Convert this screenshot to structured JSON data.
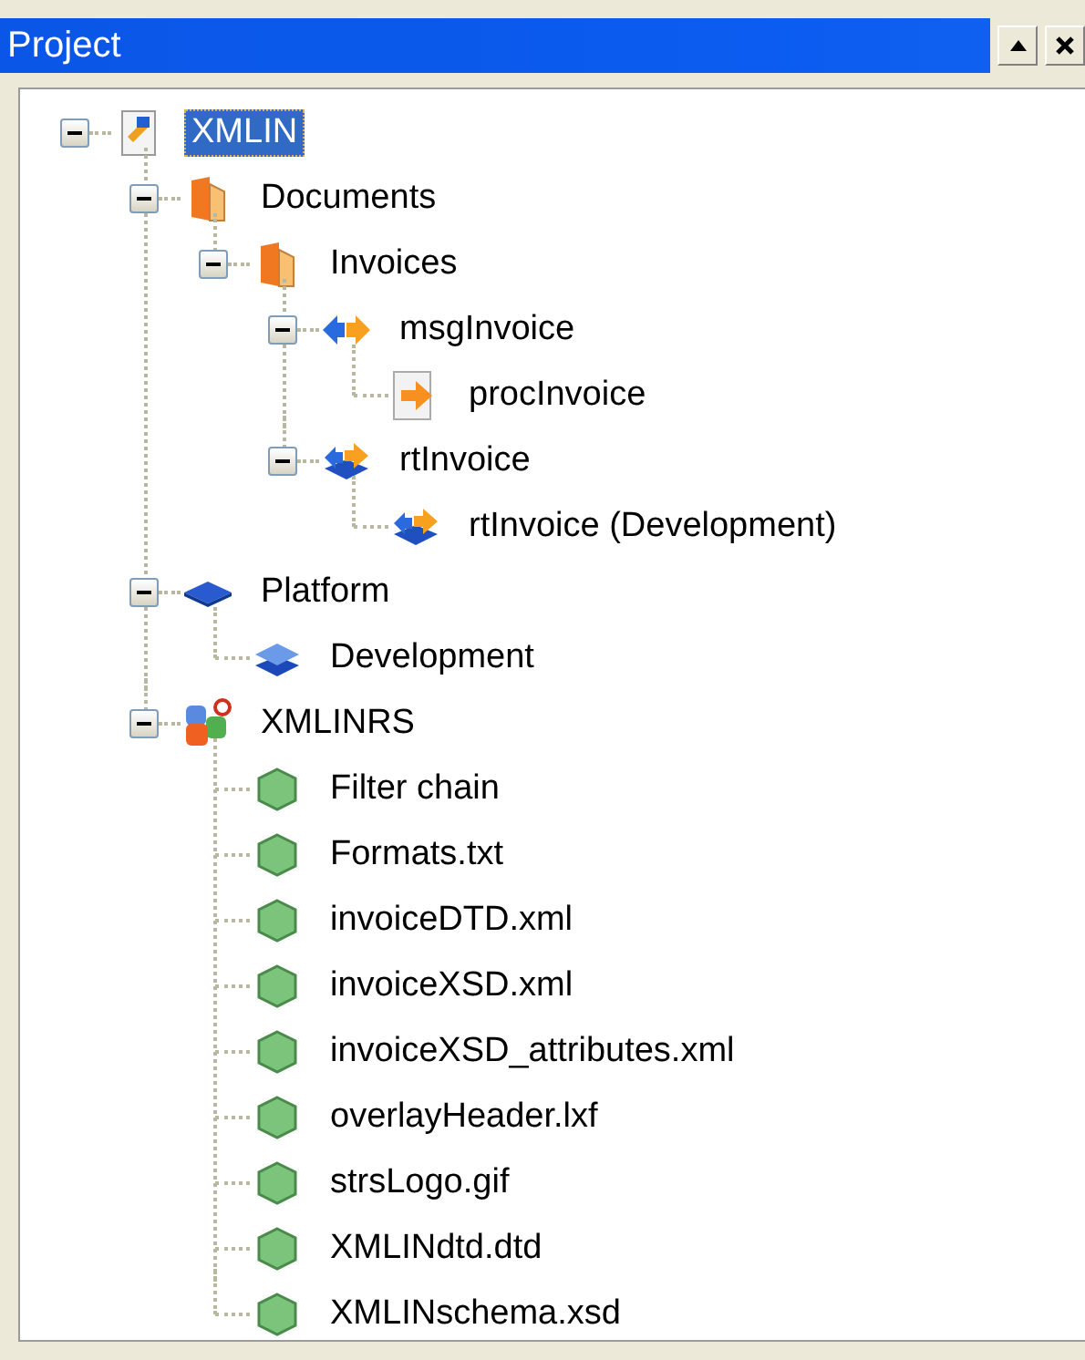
{
  "panel": {
    "title": "Project"
  },
  "tree": [
    {
      "label": "XMLIN",
      "kind": "project",
      "selected": true,
      "expanded": true,
      "children": [
        {
          "label": "Documents",
          "kind": "folder",
          "selected": false,
          "expanded": true,
          "children": [
            {
              "label": "Invoices",
              "kind": "folder",
              "selected": false,
              "expanded": true,
              "children": [
                {
                  "label": "msgInvoice",
                  "kind": "message",
                  "selected": false,
                  "expanded": true,
                  "children": [
                    {
                      "label": "procInvoice",
                      "kind": "process",
                      "selected": false
                    }
                  ]
                },
                {
                  "label": "rtInvoice",
                  "kind": "route",
                  "selected": false,
                  "expanded": true,
                  "children": [
                    {
                      "label": "rtInvoice (Development)",
                      "kind": "routeitem",
                      "selected": false
                    }
                  ]
                }
              ]
            }
          ]
        },
        {
          "label": "Platform",
          "kind": "platform",
          "selected": false,
          "expanded": true,
          "children": [
            {
              "label": "Development",
              "kind": "environment",
              "selected": false
            }
          ]
        },
        {
          "label": "XMLINRS",
          "kind": "repository",
          "selected": false,
          "expanded": true,
          "children": [
            {
              "label": "Filter chain",
              "kind": "resource",
              "selected": false
            },
            {
              "label": "Formats.txt",
              "kind": "resource",
              "selected": false
            },
            {
              "label": "invoiceDTD.xml",
              "kind": "resource",
              "selected": false
            },
            {
              "label": "invoiceXSD.xml",
              "kind": "resource",
              "selected": false
            },
            {
              "label": "invoiceXSD_attributes.xml",
              "kind": "resource",
              "selected": false
            },
            {
              "label": "overlayHeader.lxf",
              "kind": "resource",
              "selected": false
            },
            {
              "label": "strsLogo.gif",
              "kind": "resource",
              "selected": false
            },
            {
              "label": "XMLINdtd.dtd",
              "kind": "resource",
              "selected": false
            },
            {
              "label": "XMLINschema.xsd",
              "kind": "resource",
              "selected": false
            }
          ]
        }
      ]
    }
  ]
}
